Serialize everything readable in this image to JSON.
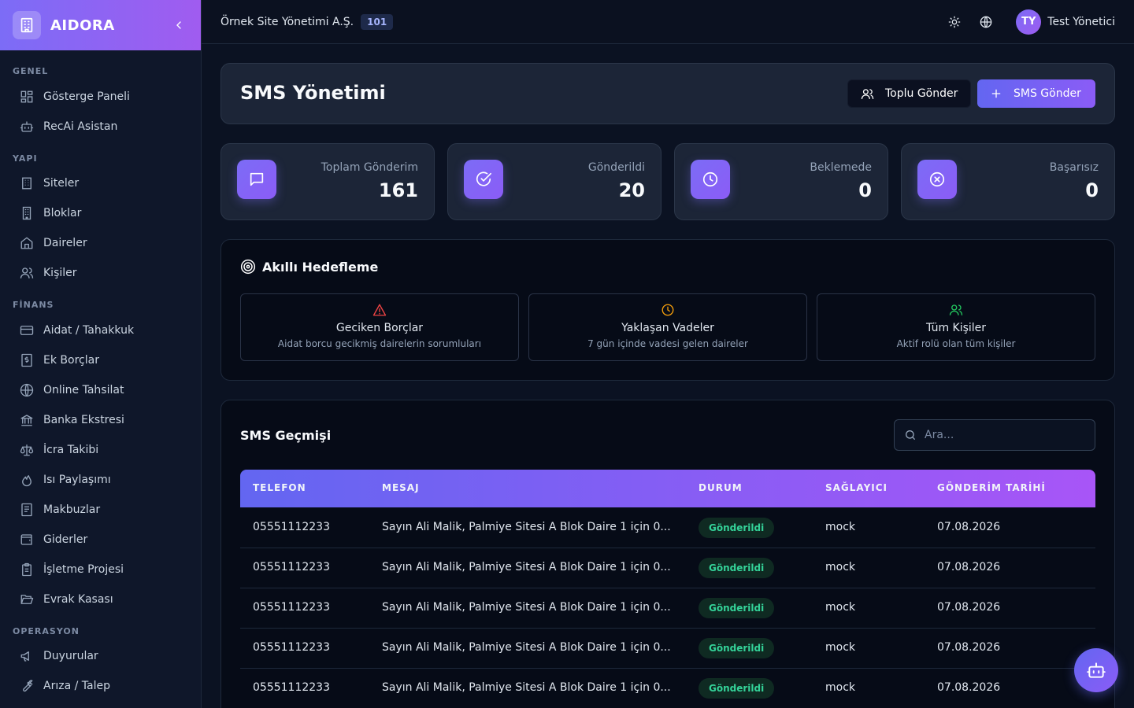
{
  "brand": {
    "name": "AIDORA"
  },
  "sidebar": {
    "sections": [
      {
        "title": "GENEL"
      },
      {
        "title": "YAPI"
      },
      {
        "title": "FİNANS"
      },
      {
        "title": "OPERASYON"
      }
    ],
    "items": [
      {
        "label": "Gösterge Paneli",
        "icon": "dashboard-icon"
      },
      {
        "label": "RecAi Asistan",
        "icon": "bot-icon"
      },
      {
        "label": "Siteler",
        "icon": "building-icon"
      },
      {
        "label": "Bloklar",
        "icon": "block-icon"
      },
      {
        "label": "Daireler",
        "icon": "home-icon"
      },
      {
        "label": "Kişiler",
        "icon": "users-icon"
      },
      {
        "label": "Aidat / Tahakkuk",
        "icon": "credit-card-icon"
      },
      {
        "label": "Ek Borçlar",
        "icon": "receipt-dollar-icon"
      },
      {
        "label": "Online Tahsilat",
        "icon": "globe-icon"
      },
      {
        "label": "Banka Ekstresi",
        "icon": "bank-icon"
      },
      {
        "label": "İcra Takibi",
        "icon": "scale-icon"
      },
      {
        "label": "Isı Paylaşımı",
        "icon": "flame-icon"
      },
      {
        "label": "Makbuzlar",
        "icon": "receipt-icon"
      },
      {
        "label": "Giderler",
        "icon": "wallet-icon"
      },
      {
        "label": "İşletme Projesi",
        "icon": "clipboard-icon"
      },
      {
        "label": "Evrak Kasası",
        "icon": "folder-open-icon"
      },
      {
        "label": "Duyurular",
        "icon": "megaphone-icon"
      },
      {
        "label": "Arıza / Talep",
        "icon": "wrench-icon"
      }
    ]
  },
  "topbar": {
    "org_name": "Örnek Site Yönetimi A.Ş.",
    "org_badge": "101",
    "user_initials": "TY",
    "user_name": "Test Yönetici"
  },
  "page": {
    "title": "SMS Yönetimi",
    "bulk_send_label": "Toplu Gönder",
    "send_label": "SMS Gönder"
  },
  "stats": [
    {
      "label": "Toplam Gönderim",
      "value": "161",
      "icon": "message-square-icon"
    },
    {
      "label": "Gönderildi",
      "value": "20",
      "icon": "check-circle-icon"
    },
    {
      "label": "Beklemede",
      "value": "0",
      "icon": "clock-icon"
    },
    {
      "label": "Başarısız",
      "value": "0",
      "icon": "x-circle-icon"
    }
  ],
  "targeting": {
    "title": "Akıllı Hedefleme",
    "options": [
      {
        "title": "Geciken Borçlar",
        "desc": "Aidat borcu gecikmiş dairelerin sorumluları",
        "icon": "alert-triangle-icon",
        "color": "#ef4444"
      },
      {
        "title": "Yaklaşan Vadeler",
        "desc": "7 gün içinde vadesi gelen daireler",
        "icon": "clock-icon",
        "color": "#f59e0b"
      },
      {
        "title": "Tüm Kişiler",
        "desc": "Aktif rolü olan tüm kişiler",
        "icon": "users-icon",
        "color": "#22c55e"
      }
    ]
  },
  "history": {
    "title": "SMS Geçmişi",
    "search_placeholder": "Ara...",
    "columns": [
      "TELEFON",
      "MESAJ",
      "DURUM",
      "SAĞLAYICI",
      "GÖNDERİM TARİHİ"
    ],
    "rows": [
      {
        "phone": "05551112233",
        "message": "Sayın Ali Malik, Palmiye Sitesi A Blok Daire 1 için 0...",
        "status": "Gönderildi",
        "provider": "mock",
        "date": "07.08.2026"
      },
      {
        "phone": "05551112233",
        "message": "Sayın Ali Malik, Palmiye Sitesi A Blok Daire 1 için 0...",
        "status": "Gönderildi",
        "provider": "mock",
        "date": "07.08.2026"
      },
      {
        "phone": "05551112233",
        "message": "Sayın Ali Malik, Palmiye Sitesi A Blok Daire 1 için 0...",
        "status": "Gönderildi",
        "provider": "mock",
        "date": "07.08.2026"
      },
      {
        "phone": "05551112233",
        "message": "Sayın Ali Malik, Palmiye Sitesi A Blok Daire 1 için 0...",
        "status": "Gönderildi",
        "provider": "mock",
        "date": "07.08.2026"
      },
      {
        "phone": "05551112233",
        "message": "Sayın Ali Malik, Palmiye Sitesi A Blok Daire 1 için 0...",
        "status": "Gönderildi",
        "provider": "mock",
        "date": "07.08.2026"
      }
    ]
  },
  "colors": {
    "accent": "#6366f1",
    "accent_purple": "#8b5cf6",
    "success": "#34d399"
  }
}
